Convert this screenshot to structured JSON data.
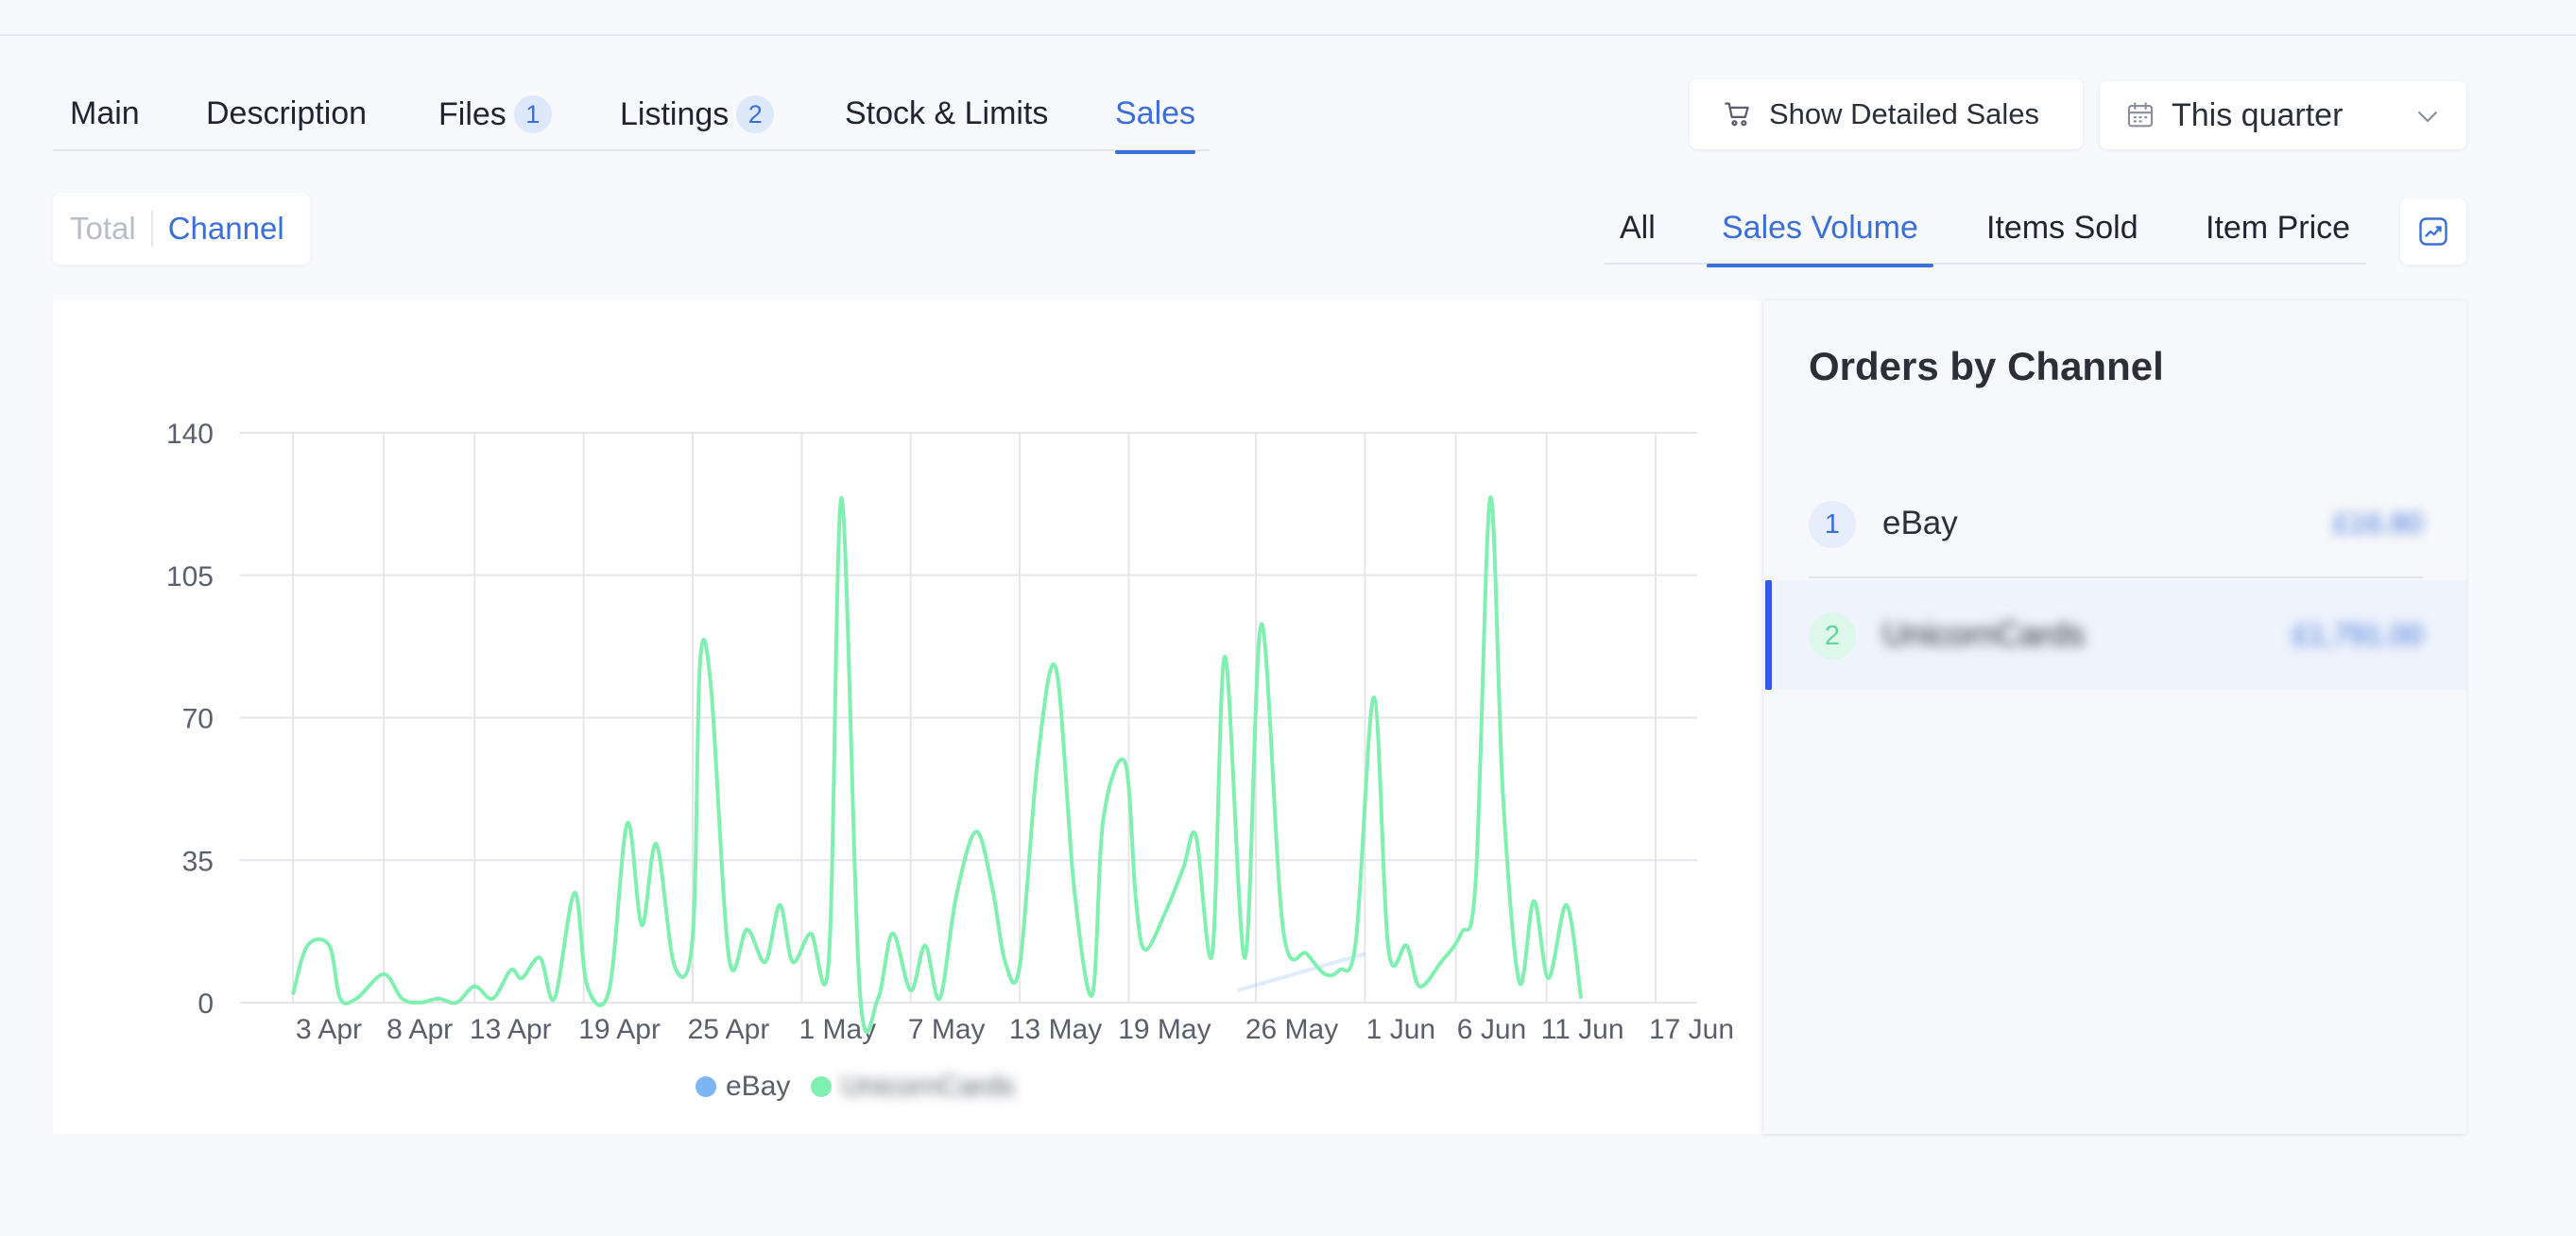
{
  "tabs": [
    {
      "label": "Main"
    },
    {
      "label": "Description"
    },
    {
      "label": "Files",
      "badge": "1"
    },
    {
      "label": "Listings",
      "badge": "2"
    },
    {
      "label": "Stock & Limits"
    },
    {
      "label": "Sales",
      "active": true
    }
  ],
  "toolbar": {
    "detailed_sales_label": "Show Detailed Sales",
    "period_label": "This quarter"
  },
  "view_toggle": {
    "total_label": "Total",
    "channel_label": "Channel",
    "active": "Channel"
  },
  "metric_tabs": [
    {
      "label": "All"
    },
    {
      "label": "Sales Volume",
      "active": true
    },
    {
      "label": "Items Sold"
    },
    {
      "label": "Item Price"
    }
  ],
  "icons": {
    "detailed_sales": "cart-icon",
    "period": "calendar-icon",
    "period_dropdown": "chevron-down-icon",
    "chart_toggle": "line-chart-icon"
  },
  "colors": {
    "accent": "#3b6fd8",
    "ebay": "#7cb5f2",
    "unicorncards": "#7ff0b0",
    "selected_row_bar": "#2f5be0"
  },
  "orders_by_channel": {
    "title": "Orders by Channel",
    "rows": [
      {
        "rank": "1",
        "name": "eBay",
        "value": "£16.80",
        "obscured_value": true
      },
      {
        "rank": "2",
        "name": "UnicornCards",
        "value": "£1,791.00",
        "obscured_name": true,
        "obscured_value": true,
        "selected": true
      }
    ]
  },
  "chart_data": {
    "type": "line",
    "xlabel": "",
    "ylabel": "",
    "ylim": [
      0,
      140
    ],
    "y_ticks": [
      0,
      35,
      70,
      105,
      140
    ],
    "x_tick_labels": [
      "3 Apr",
      "8 Apr",
      "13 Apr",
      "19 Apr",
      "25 Apr",
      "1 May",
      "7 May",
      "13 May",
      "19 May",
      "26 May",
      "1 Jun",
      "6 Jun",
      "11 Jun",
      "17 Jun"
    ],
    "x_tick_days": [
      0,
      5,
      10,
      16,
      22,
      28,
      34,
      40,
      46,
      53,
      59,
      64,
      69,
      75
    ],
    "grid": true,
    "legend_position": "bottom-center",
    "series": [
      {
        "name": "eBay",
        "color": "#7cb5f2",
        "points": [
          [
            52,
            3
          ],
          [
            59,
            12
          ]
        ]
      },
      {
        "name": "UnicornCards",
        "obscured_name": true,
        "color": "#7ff0b0",
        "points": [
          [
            0,
            2
          ],
          [
            0.8,
            14
          ],
          [
            2,
            14
          ],
          [
            2.6,
            1
          ],
          [
            3.5,
            1
          ],
          [
            5,
            7
          ],
          [
            6,
            1
          ],
          [
            7,
            0
          ],
          [
            8,
            1
          ],
          [
            9,
            0
          ],
          [
            10,
            4
          ],
          [
            11,
            1
          ],
          [
            12,
            8
          ],
          [
            12.6,
            6
          ],
          [
            13.6,
            11
          ],
          [
            14.4,
            1
          ],
          [
            15.5,
            27
          ],
          [
            16.2,
            4
          ],
          [
            17.4,
            3
          ],
          [
            18.4,
            44
          ],
          [
            19.2,
            19
          ],
          [
            20,
            39
          ],
          [
            21,
            9
          ],
          [
            22,
            16
          ],
          [
            22.4,
            83
          ],
          [
            23,
            78
          ],
          [
            24,
            11
          ],
          [
            25,
            18
          ],
          [
            26,
            10
          ],
          [
            26.8,
            24
          ],
          [
            27.5,
            10
          ],
          [
            28.5,
            17
          ],
          [
            29.5,
            11
          ],
          [
            30.2,
            124
          ],
          [
            31.2,
            3
          ],
          [
            32.2,
            1
          ],
          [
            33,
            17
          ],
          [
            34,
            3
          ],
          [
            34.8,
            14
          ],
          [
            35.6,
            1
          ],
          [
            36.5,
            26
          ],
          [
            37.6,
            42
          ],
          [
            38.5,
            28
          ],
          [
            39.2,
            10
          ],
          [
            40,
            9
          ],
          [
            41,
            60
          ],
          [
            42,
            82
          ],
          [
            43,
            28
          ],
          [
            44,
            2
          ],
          [
            44.6,
            45
          ],
          [
            45.8,
            59
          ],
          [
            46.4,
            25
          ],
          [
            46.9,
            13
          ],
          [
            48,
            22
          ],
          [
            49,
            33
          ],
          [
            49.7,
            41
          ],
          [
            50.6,
            12
          ],
          [
            51.3,
            85
          ],
          [
            52.4,
            11
          ],
          [
            53.3,
            93
          ],
          [
            54.5,
            18
          ],
          [
            55.8,
            12
          ],
          [
            56.8,
            7
          ],
          [
            57.6,
            8
          ],
          [
            58.5,
            15
          ],
          [
            59.5,
            75
          ],
          [
            60.3,
            13
          ],
          [
            61.3,
            14
          ],
          [
            62,
            4
          ],
          [
            63.2,
            10
          ],
          [
            64.3,
            17
          ],
          [
            65.1,
            30
          ],
          [
            65.9,
            124
          ],
          [
            66.6,
            51
          ],
          [
            67.5,
            5
          ],
          [
            68.3,
            25
          ],
          [
            69.1,
            6
          ],
          [
            70.1,
            24
          ],
          [
            70.9,
            1
          ]
        ]
      }
    ]
  }
}
